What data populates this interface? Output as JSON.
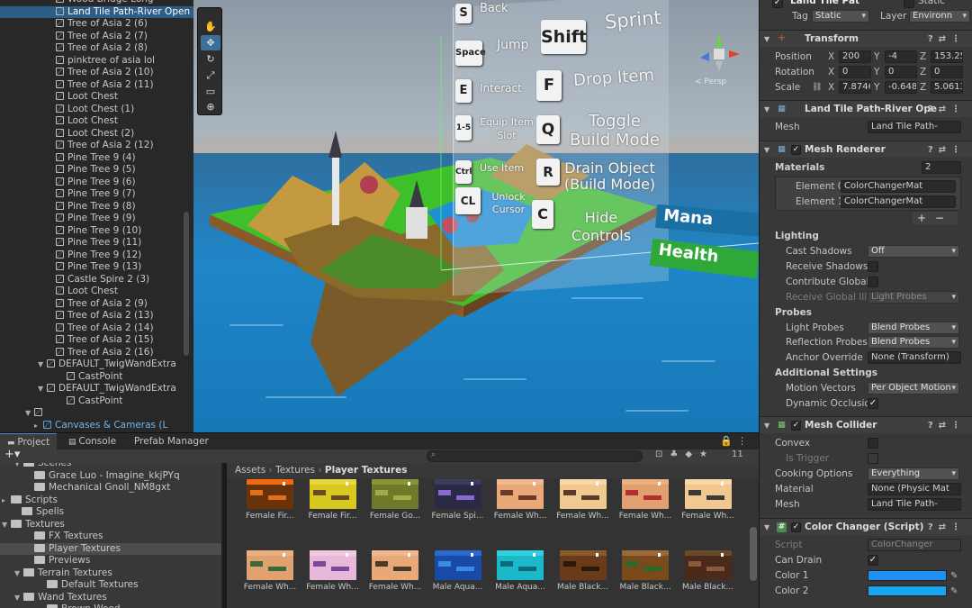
{
  "hierarchy": {
    "items": [
      {
        "label": "Wood Bridge Long",
        "indent": 62,
        "selected": false
      },
      {
        "label": "Land Tile Path-River Open",
        "indent": 62,
        "selected": true
      },
      {
        "label": "Tree of Asia 2 (6)",
        "indent": 62
      },
      {
        "label": "Tree of Asia 2 (7)",
        "indent": 62
      },
      {
        "label": "Tree of Asia 2 (8)",
        "indent": 62
      },
      {
        "label": "pinktree of asia lol",
        "indent": 62
      },
      {
        "label": "Tree of Asia 2 (10)",
        "indent": 62
      },
      {
        "label": "Tree of Asia 2 (11)",
        "indent": 62
      },
      {
        "label": "Loot Chest",
        "indent": 62
      },
      {
        "label": "Loot Chest (1)",
        "indent": 62
      },
      {
        "label": "Loot Chest",
        "indent": 62
      },
      {
        "label": "Loot Chest (2)",
        "indent": 62
      },
      {
        "label": "Tree of Asia 2 (12)",
        "indent": 62
      },
      {
        "label": "Pine Tree 9 (4)",
        "indent": 62
      },
      {
        "label": "Pine Tree 9 (5)",
        "indent": 62
      },
      {
        "label": "Pine Tree 9 (6)",
        "indent": 62
      },
      {
        "label": "Pine Tree 9 (7)",
        "indent": 62
      },
      {
        "label": "Pine Tree 9 (8)",
        "indent": 62
      },
      {
        "label": "Pine Tree 9 (9)",
        "indent": 62
      },
      {
        "label": "Pine Tree 9 (10)",
        "indent": 62
      },
      {
        "label": "Pine Tree 9 (11)",
        "indent": 62
      },
      {
        "label": "Pine Tree 9 (12)",
        "indent": 62
      },
      {
        "label": "Pine Tree 9 (13)",
        "indent": 62
      },
      {
        "label": "Castle Spire 2 (3)",
        "indent": 62
      },
      {
        "label": "Loot Chest",
        "indent": 62
      },
      {
        "label": "Tree of Asia 2 (9)",
        "indent": 62
      },
      {
        "label": "Tree of Asia 2 (13)",
        "indent": 62
      },
      {
        "label": "Tree of Asia 2 (14)",
        "indent": 62
      },
      {
        "label": "Tree of Asia 2 (15)",
        "indent": 62
      },
      {
        "label": "Tree of Asia 2 (16)",
        "indent": 62
      },
      {
        "label": "DEFAULT_TwigWandExtra",
        "indent": 52,
        "arrow": "▼"
      },
      {
        "label": "CastPoint",
        "indent": 74
      },
      {
        "label": "DEFAULT_TwigWandExtra",
        "indent": 52,
        "arrow": "▼"
      },
      {
        "label": "CastPoint",
        "indent": 74
      },
      {
        "label": "",
        "indent": 38,
        "arrow": "▼"
      },
      {
        "label": "Canvases & Cameras (L",
        "indent": 48,
        "arrow": "▸",
        "blue": true
      }
    ]
  },
  "scene": {
    "panel_keys": [
      {
        "key": "S",
        "action": "Back"
      },
      {
        "key": "Space",
        "action": "Jump"
      },
      {
        "key": "Shift",
        "action": "Sprint"
      },
      {
        "key": "E",
        "action": "Interact"
      },
      {
        "key": "F",
        "action": "Drop Item"
      },
      {
        "key": "1-5",
        "action": "Equip Item Slot"
      },
      {
        "key": "Q",
        "action": "Toggle Build Mode"
      },
      {
        "key": "Ctrl",
        "action": "Use Item"
      },
      {
        "key": "R",
        "action": "Drain Object (Build Mode)"
      },
      {
        "key": "CL",
        "action": "Unlock Cursor"
      },
      {
        "key": "C",
        "action": "Hide Controls"
      }
    ],
    "mana_label": "Mana",
    "health_label": "Health",
    "persp_label": "< Persp",
    "mana_color": "#1a6fa3",
    "health_color": "#2fa83a"
  },
  "inspector": {
    "top_static": "Static",
    "top_name": "Land Tile Pat",
    "tag_label": "Tag",
    "tag_value": "Static",
    "layer_label": "Layer",
    "layer_value": "Environn",
    "transform": {
      "title": "Transform",
      "position_label": "Position",
      "pos": [
        "200",
        "-4",
        "153.25"
      ],
      "rotation_label": "Rotation",
      "rot": [
        "0",
        "0",
        "0"
      ],
      "scale_label": "Scale",
      "scale": [
        "7.8746",
        "-0.648",
        "5.0613"
      ]
    },
    "meshfilter": {
      "title": "Land Tile Path-River Ope",
      "mesh_label": "Mesh",
      "mesh_value": "Land Tile Path-"
    },
    "meshrenderer": {
      "title": "Mesh Renderer",
      "materials_label": "Materials",
      "materials_count": "2",
      "elements": [
        {
          "label": "Element 0",
          "value": "ColorChangerMat"
        },
        {
          "label": "Element 1",
          "value": "ColorChangerMat"
        }
      ],
      "lighting_label": "Lighting",
      "cast_shadows_label": "Cast Shadows",
      "cast_shadows_value": "Off",
      "receive_shadows_label": "Receive Shadows",
      "contribute_gi_label": "Contribute Global I",
      "receive_gi_label": "Receive Global Illu",
      "receive_gi_value": "Light Probes",
      "probes_label": "Probes",
      "light_probes_label": "Light Probes",
      "light_probes_value": "Blend Probes",
      "reflection_probes_label": "Reflection Probes",
      "reflection_probes_value": "Blend Probes",
      "anchor_override_label": "Anchor Override",
      "anchor_override_value": "None (Transform)",
      "additional_label": "Additional Settings",
      "motion_vectors_label": "Motion Vectors",
      "motion_vectors_value": "Per Object Motion",
      "dynamic_occlusion_label": "Dynamic Occlusio"
    },
    "meshcollider": {
      "title": "Mesh Collider",
      "convex_label": "Convex",
      "trigger_label": "Is Trigger",
      "cooking_label": "Cooking Options",
      "cooking_value": "Everything",
      "material_label": "Material",
      "material_value": "None (Physic Mat",
      "mesh_label": "Mesh",
      "mesh_value": "Land Tile Path-"
    },
    "colorchanger": {
      "title": "Color Changer (Script)",
      "script_label": "Script",
      "script_value": "ColorChanger",
      "can_drain_label": "Can Drain",
      "color1_label": "Color 1",
      "color1": "#1f8ff0",
      "color2_label": "Color 2",
      "color2": "#18a8f2"
    }
  },
  "project": {
    "tabs": [
      "Project",
      "Console",
      "Prefab Manager"
    ],
    "badge": "11",
    "tree": [
      {
        "label": "Scenes",
        "indent": 28,
        "arrow": "▼"
      },
      {
        "label": "Grace Luo - Imagine_kkjPYq",
        "indent": 38
      },
      {
        "label": "Mechanical Gnoll_NM8gxt",
        "indent": 38
      },
      {
        "label": "Scripts",
        "indent": 14,
        "arrow": "▸"
      },
      {
        "label": "Spells",
        "indent": 24
      },
      {
        "label": "Textures",
        "indent": 14,
        "arrow": "▼"
      },
      {
        "label": "FX Textures",
        "indent": 38
      },
      {
        "label": "Player Textures",
        "indent": 38,
        "selected": true
      },
      {
        "label": "Previews",
        "indent": 38
      },
      {
        "label": "Terrain Textures",
        "indent": 28,
        "arrow": "▼"
      },
      {
        "label": "Default Textures",
        "indent": 52
      },
      {
        "label": "Wand Textures",
        "indent": 28,
        "arrow": "▼"
      },
      {
        "label": "Brown Wood",
        "indent": 52
      }
    ],
    "breadcrumb": [
      "Assets",
      "Textures",
      "Player Textures"
    ],
    "assets": [
      {
        "label": "Female Fir...",
        "bg": "#6a3208",
        "fg": "#e0701a",
        "top": "#f06a10"
      },
      {
        "label": "Female Fir...",
        "bg": "#d8c820",
        "fg": "#6a4a20",
        "top": "#e8d840"
      },
      {
        "label": "Female Go...",
        "bg": "#6e7a2a",
        "fg": "#a2ac4a",
        "top": "#8a9438"
      },
      {
        "label": "Female Spi...",
        "bg": "#2a2a44",
        "fg": "#8a6ad0",
        "top": "#3c3c5c"
      },
      {
        "label": "Female Wh...",
        "bg": "#e8a878",
        "fg": "#6a3a2a",
        "top": "#f0b890"
      },
      {
        "label": "Female Wh...",
        "bg": "#f0c890",
        "fg": "#5a3a2a",
        "top": "#f8d8a8"
      },
      {
        "label": "Female Wh...",
        "bg": "#e0a070",
        "fg": "#b03030",
        "top": "#eab080"
      },
      {
        "label": "Female Wh...",
        "bg": "#f0c890",
        "fg": "#3a3a3a",
        "top": "#f8d8a8"
      },
      {
        "label": "Female Wh...",
        "bg": "#e0a070",
        "fg": "#3a6a3a",
        "top": "#eab080"
      },
      {
        "label": "Female Wh...",
        "bg": "#e8b8d8",
        "fg": "#7a4a9a",
        "top": "#f0c8e0"
      },
      {
        "label": "Female Wh...",
        "bg": "#e8a878",
        "fg": "#4a3a2a",
        "top": "#f0b890"
      },
      {
        "label": "Male Aqua...",
        "bg": "#1a4aa8",
        "fg": "#3a8ae8",
        "top": "#2a6ad0"
      },
      {
        "label": "Male Aqua...",
        "bg": "#1ab8c8",
        "fg": "#0a6a7a",
        "top": "#30d0e0"
      },
      {
        "label": "Male Black...",
        "bg": "#6a3a1a",
        "fg": "#2a1a0a",
        "top": "#8a5a2a"
      },
      {
        "label": "Male Black...",
        "bg": "#7a4a1a",
        "fg": "#2a6a2a",
        "top": "#9a6a3a"
      },
      {
        "label": "Male Black...",
        "bg": "#4a2a1a",
        "fg": "#8a5a3a",
        "top": "#6a4a2a"
      }
    ]
  }
}
